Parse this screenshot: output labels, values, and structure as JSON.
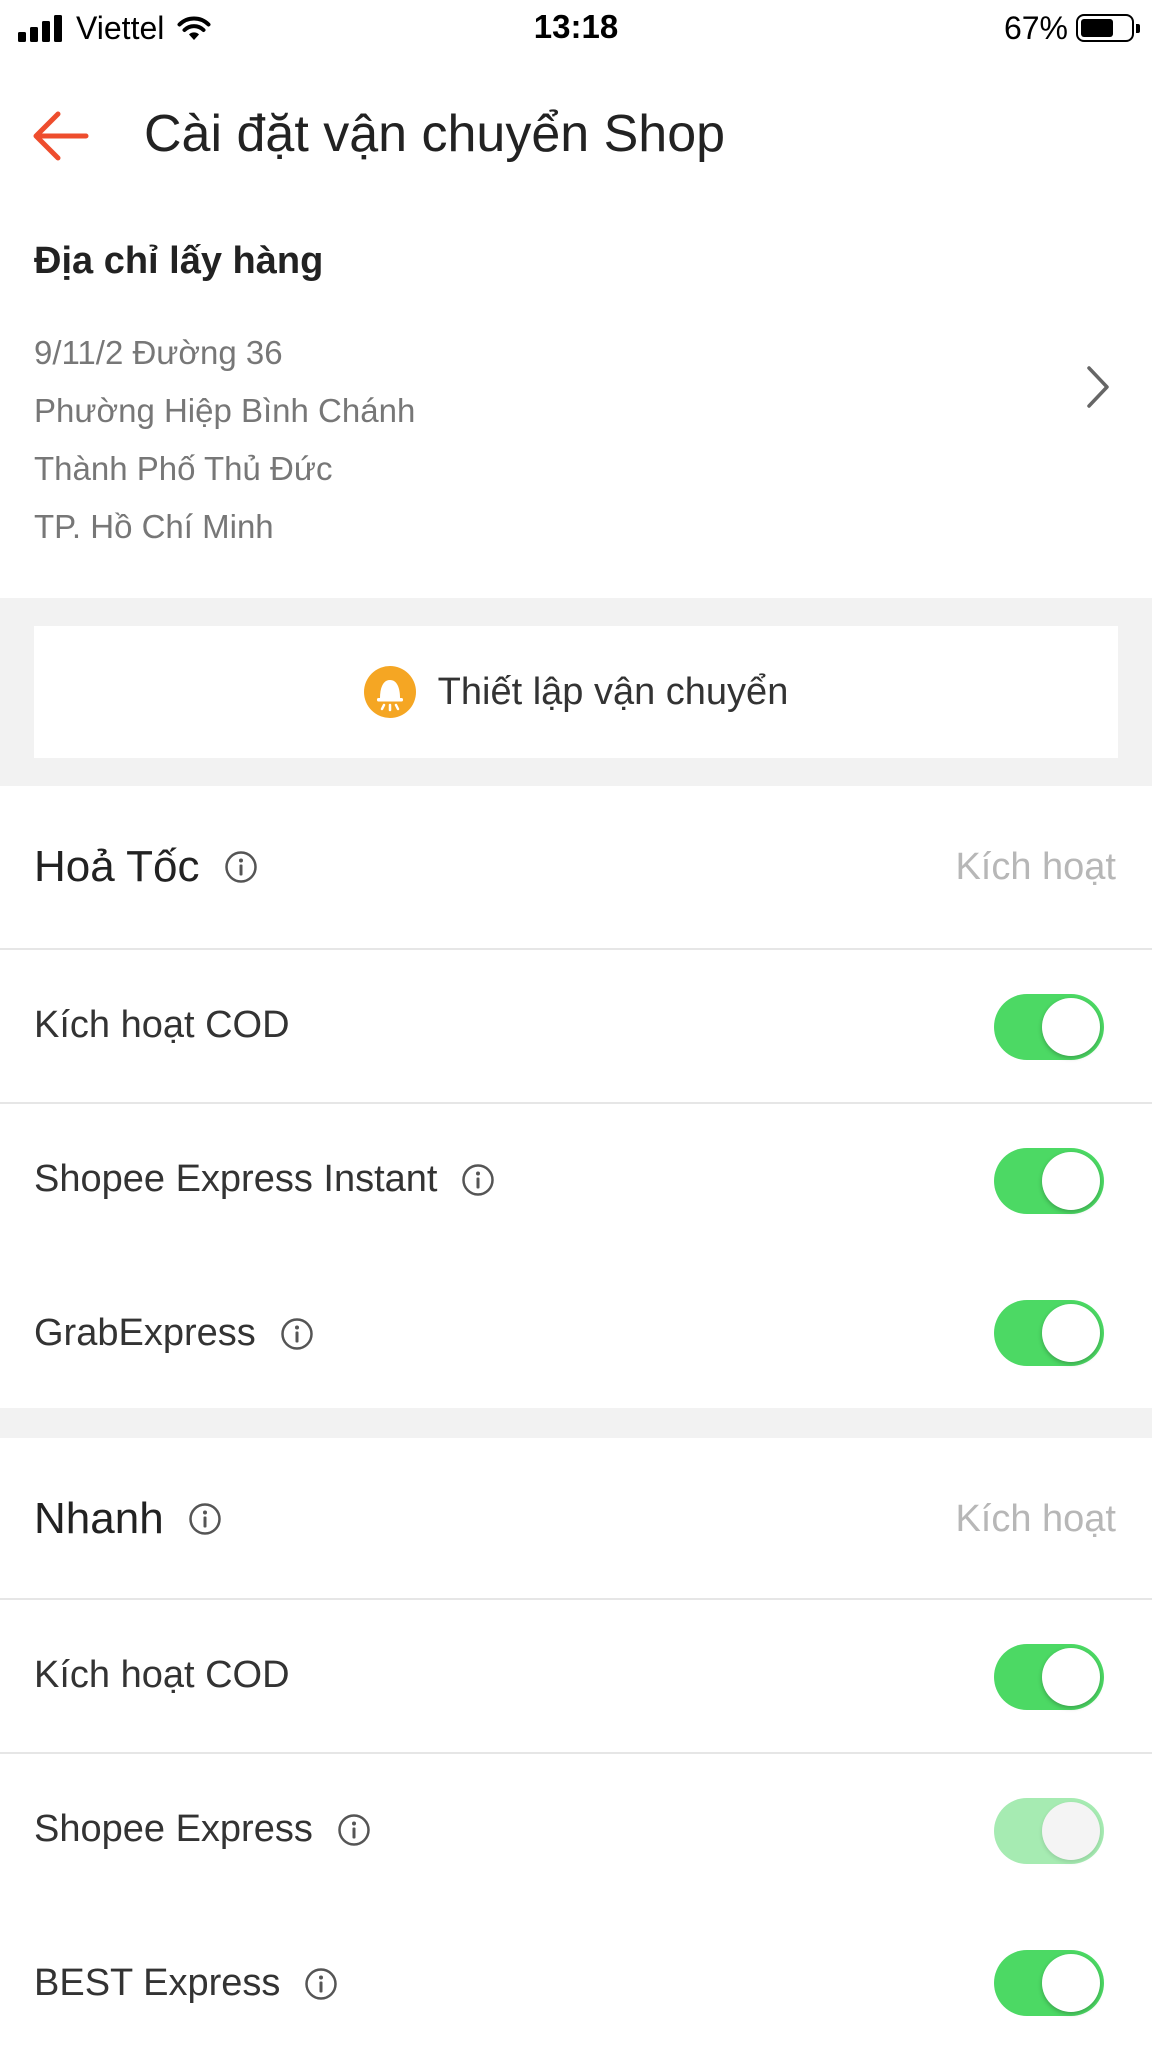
{
  "status_bar": {
    "carrier": "Viettel",
    "time": "13:18",
    "battery": "67%",
    "battery_level": 0.67,
    "icons": [
      "signal-icon",
      "wifi-icon",
      "battery-icon"
    ]
  },
  "header": {
    "title": "Cài đặt vận chuyển Shop",
    "back_icon": "back-arrow-icon",
    "accent_color": "#ee4d2d"
  },
  "address": {
    "title": "Địa chỉ lấy hàng",
    "lines": [
      "9/11/2 Đường 36",
      "Phường Hiệp Bình Chánh",
      "Thành Phố Thủ Đức",
      "TP. Hồ Chí Minh"
    ]
  },
  "setup": {
    "label": "Thiết lập vận chuyển",
    "icon": "bell-icon",
    "icon_color": "#f5a623"
  },
  "sections": [
    {
      "title": "Hoả Tốc",
      "action": "Kích hoạt",
      "items": [
        {
          "label": "Kích hoạt COD",
          "on": true,
          "enabled": true
        },
        {
          "label": "Shopee Express Instant",
          "on": true,
          "enabled": true
        },
        {
          "label": "GrabExpress",
          "on": true,
          "enabled": true
        }
      ]
    },
    {
      "title": "Nhanh",
      "action": "Kích hoạt",
      "items": [
        {
          "label": "Kích hoạt COD",
          "on": true,
          "enabled": true
        },
        {
          "label": "Shopee Express",
          "on": true,
          "enabled": false
        },
        {
          "label": "BEST Express",
          "on": true,
          "enabled": true
        }
      ]
    }
  ],
  "toggle_color": "#4cd964"
}
